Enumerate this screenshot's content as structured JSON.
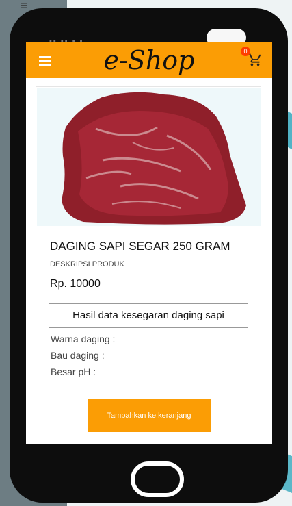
{
  "app": {
    "brand": "e-Shop",
    "cart_count": "0"
  },
  "product": {
    "name": "DAGING SAPI SEGAR 250 GRAM",
    "description_label": "DESKRIPSI PRODUK",
    "price": "Rp. 10000"
  },
  "freshness": {
    "title": "Hasil data kesegaran daging sapi",
    "color_label": "Warna daging  :",
    "smell_label": "Bau daging  :",
    "ph_label": "Besar pH :"
  },
  "actions": {
    "add_to_cart": "Tambahkan ke keranjang"
  },
  "colors": {
    "appbar": "#fb9d05",
    "button": "#fb9d05",
    "badge": "#ff3d00"
  }
}
